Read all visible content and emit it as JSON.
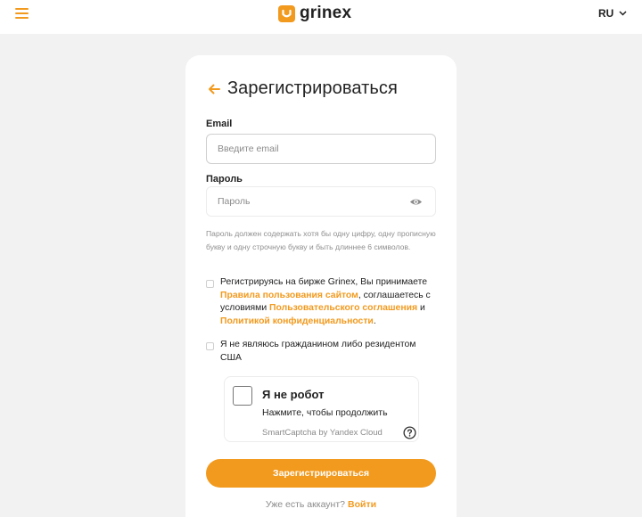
{
  "header": {
    "logo_text": "grinex",
    "lang": "RU"
  },
  "form": {
    "title": "Зарегистрироваться",
    "email_label": "Email",
    "email_placeholder": "Введите email",
    "password_label": "Пароль",
    "password_placeholder": "Пароль",
    "password_hint": "Пароль должен содержать хотя бы одну цифру, одну прописную букву и одну строчную букву и быть длиннее 6 символов.",
    "terms": {
      "text_1": "Регистрируясь на бирже Grinex, Вы принимаете ",
      "link_1": "Правила пользования сайтом",
      "text_2": ", соглашаетесь с условиями ",
      "link_2": "Пользовательского соглашения",
      "text_3": " и ",
      "link_3": "Политикой конфиденциальности",
      "text_4": "."
    },
    "us_check": "Я не являюсь гражданином либо резидентом США",
    "captcha": {
      "title": "Я не робот",
      "subtitle": "Нажмите, чтобы продолжить",
      "brand": "SmartCaptcha by Yandex Cloud"
    },
    "submit_label": "Зарегистрироваться",
    "login_prompt": "Уже есть аккаунт?",
    "login_link": "Войти"
  },
  "colors": {
    "accent": "#f29a1e",
    "background": "#f2f2f2"
  },
  "icons": [
    "menu-icon",
    "logo-icon",
    "chevron-down-icon",
    "arrow-left-icon",
    "eye-icon",
    "help-icon"
  ]
}
